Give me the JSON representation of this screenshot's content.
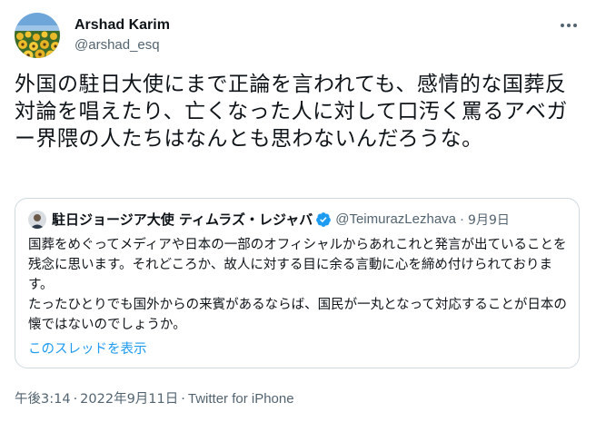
{
  "tweet": {
    "author": {
      "display_name": "Arshad Karim",
      "handle": "@arshad_esq",
      "avatar_icon": "sunflower-field-avatar"
    },
    "more_icon": "more-horizontal-icon",
    "text": "外国の駐日大使にまで正論を言われても、感情的な国葬反対論を唱えたり、亡くなった人に対して口汚く罵るアベガー界隈の人たちはなんとも思わないんだろうな。",
    "quote": {
      "author_name": "駐日ジョージア大使 ティムラズ・レジャバ",
      "verified_icon": "verified-badge-icon",
      "handle": "@TeimurazLezhava",
      "separator": "·",
      "date": "9月9日",
      "text_paragraphs": [
        "国葬をめぐってメディアや日本の一部のオフィシャルからあれこれと発言が出ていることを残念に思います。それどころか、故人に対する目に余る言動に心を締め付けられております。",
        "たったひとりでも国外からの来賓があるならば、国民が一丸となって対応することが日本の懐ではないのでしょうか。"
      ],
      "show_thread": "このスレッドを表示"
    },
    "meta": {
      "time": "午後3:14",
      "separator": "·",
      "date": "2022年9月11日",
      "source": "Twitter for iPhone"
    }
  },
  "colors": {
    "text_primary": "#0f1419",
    "text_secondary": "#536471",
    "link": "#1d9bf0",
    "border": "#cfd9de",
    "verified": "#1d9bf0"
  }
}
